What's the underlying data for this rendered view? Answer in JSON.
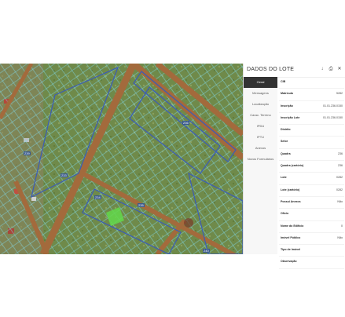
{
  "panel": {
    "title": "DADOS DO LOTE",
    "icons": [
      "download-icon",
      "print-icon",
      "close-icon"
    ]
  },
  "tabs": [
    {
      "label": "Geral",
      "active": true
    },
    {
      "label": "Mensagens",
      "active": false
    },
    {
      "label": "Localização",
      "active": false
    },
    {
      "label": "Carac. Terreno",
      "active": false
    },
    {
      "label": "IPDU",
      "active": false
    },
    {
      "label": "IPTU",
      "active": false
    },
    {
      "label": "Anexos",
      "active": false
    },
    {
      "label": "Novos Formulários",
      "active": false
    }
  ],
  "fields": [
    {
      "label": "CIB",
      "value": ""
    },
    {
      "label": "Matrícula",
      "value": "5282"
    },
    {
      "label": "Inscrição",
      "value": "01.01.236.0150"
    },
    {
      "label": "Inscrição Lote",
      "value": "01.01.236.0150"
    },
    {
      "label": "Distrito",
      "value": ""
    },
    {
      "label": "Setor",
      "value": ""
    },
    {
      "label": "Quadra",
      "value": "236"
    },
    {
      "label": "Quadra (cartório)",
      "value": "236"
    },
    {
      "label": "Lote",
      "value": "0282"
    },
    {
      "label": "Lote (cartório)",
      "value": "0282"
    },
    {
      "label": "Possui Anexos",
      "value": "Não"
    },
    {
      "label": "Ofício",
      "value": ""
    },
    {
      "label": "Nome do Edifício",
      "value": "0"
    },
    {
      "label": "Imóvel Público",
      "value": "Não"
    },
    {
      "label": "Tipo de Imóvel",
      "value": ""
    },
    {
      "label": "Observação",
      "value": ""
    }
  ],
  "map": {
    "block_labels": [
      "236",
      "233",
      "234",
      "235",
      "239",
      "240"
    ]
  }
}
